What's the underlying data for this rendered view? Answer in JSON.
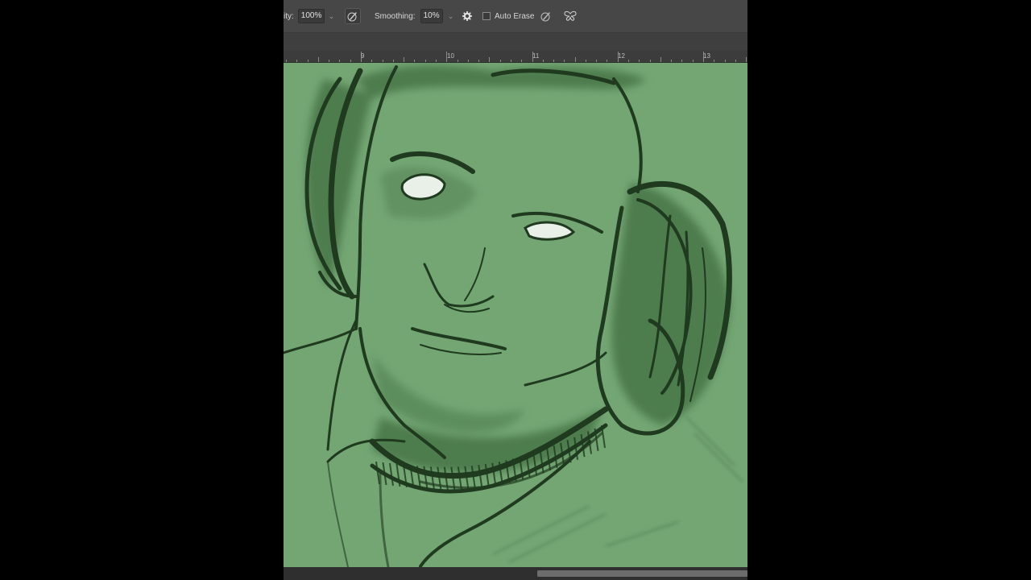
{
  "options_bar": {
    "opacity_label": "ity:",
    "opacity_value": "100%",
    "smoothing_label": "Smoothing:",
    "smoothing_value": "10%",
    "auto_erase_label": "Auto Erase",
    "auto_erase_checked": false
  },
  "ruler": {
    "labels": [
      "9",
      "10",
      "11",
      "12",
      "13"
    ]
  },
  "canvas": {
    "background_color": "#74a674",
    "stroke_color": "#1f3a1f"
  },
  "icons": {
    "opacity_dropdown": "chevron-down-icon",
    "pressure_opacity": "pen-pressure-icon",
    "smoothing_dropdown": "chevron-down-icon",
    "smoothing_options": "gear-icon",
    "pressure_size": "pen-pressure-size-icon",
    "symmetry": "butterfly-icon"
  }
}
